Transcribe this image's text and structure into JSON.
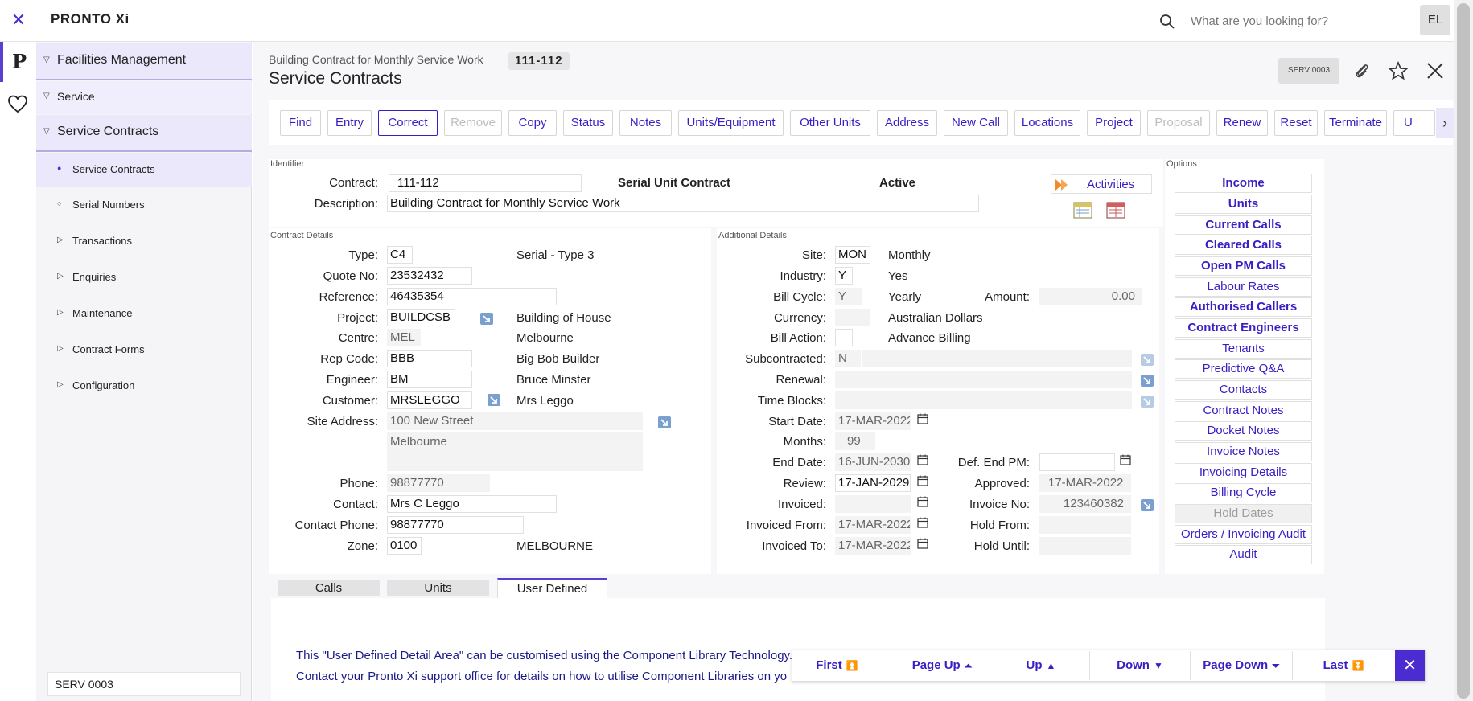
{
  "app": {
    "logo": "PRONTO Xi",
    "search_placeholder": "What are you looking for?",
    "avatar": "EL"
  },
  "sidebar": {
    "items": [
      {
        "label": "Facilities Management"
      },
      {
        "label": "Service"
      },
      {
        "label": "Service Contracts"
      },
      {
        "label": "Service Contracts"
      },
      {
        "label": "Serial Numbers"
      },
      {
        "label": "Transactions"
      },
      {
        "label": "Enquiries"
      },
      {
        "label": "Maintenance"
      },
      {
        "label": "Contract Forms"
      },
      {
        "label": "Configuration"
      }
    ],
    "footer": "SERV 0003"
  },
  "header": {
    "breadcrumb": "Building Contract for Monthly Service Work",
    "badge": "111-112",
    "title": "Service Contracts",
    "program_code": "SERV 0003"
  },
  "toolbar": {
    "buttons": [
      {
        "label": "Find",
        "state": "normal"
      },
      {
        "label": "Entry",
        "state": "normal"
      },
      {
        "label": "Correct",
        "state": "active"
      },
      {
        "label": "Remove",
        "state": "disabled"
      },
      {
        "label": "Copy",
        "state": "normal"
      },
      {
        "label": "Status",
        "state": "normal"
      },
      {
        "label": "Notes",
        "state": "normal"
      },
      {
        "label": "Units/Equipment",
        "state": "normal"
      },
      {
        "label": "Other Units",
        "state": "normal"
      },
      {
        "label": "Address",
        "state": "normal"
      },
      {
        "label": "New Call",
        "state": "normal"
      },
      {
        "label": "Locations",
        "state": "normal"
      },
      {
        "label": "Project",
        "state": "normal"
      },
      {
        "label": "Proposal",
        "state": "disabled"
      },
      {
        "label": "Renew",
        "state": "normal"
      },
      {
        "label": "Reset",
        "state": "normal"
      },
      {
        "label": "Terminate",
        "state": "normal"
      },
      {
        "label": "U",
        "state": "normal"
      }
    ]
  },
  "identifier": {
    "section": "Identifier",
    "contract_label": "Contract:",
    "contract": "111-112",
    "contract_type": "Serial Unit Contract",
    "status": "Active",
    "description_label": "Description:",
    "description": "Building Contract for Monthly Service Work",
    "activities": "Activities"
  },
  "contract_details": {
    "section": "Contract Details",
    "type_label": "Type:",
    "type": "C4",
    "type_desc": "Serial - Type 3",
    "quote_label": "Quote No:",
    "quote": "23532432",
    "reference_label": "Reference:",
    "reference": "46435354",
    "project_label": "Project:",
    "project": "BUILDCSB",
    "project_desc": "Building of House",
    "centre_label": "Centre:",
    "centre": "MEL",
    "centre_desc": "Melbourne",
    "rep_label": "Rep Code:",
    "rep": "BBB",
    "rep_desc": "Big Bob Builder",
    "engineer_label": "Engineer:",
    "engineer": "BM",
    "engineer_desc": "Bruce Minster",
    "customer_label": "Customer:",
    "customer": "MRSLEGGO",
    "customer_desc": "Mrs Leggo",
    "site_label": "Site Address:",
    "site_line1": "100 New Street",
    "site_line2": "Melbourne",
    "phone_label": "Phone:",
    "phone": "98877770",
    "contact_label": "Contact:",
    "contact": "Mrs C Leggo",
    "contact_phone_label": "Contact Phone:",
    "contact_phone": "98877770",
    "zone_label": "Zone:",
    "zone": "0100",
    "zone_desc": "MELBOURNE"
  },
  "additional": {
    "section": "Additional Details",
    "site_label": "Site:",
    "site": "MON",
    "site_desc": "Monthly",
    "industry_label": "Industry:",
    "industry": "Y",
    "industry_desc": "Yes",
    "bill_cycle_label": "Bill Cycle:",
    "bill_cycle": "Y",
    "bill_cycle_desc": "Yearly",
    "amount_label": "Amount:",
    "amount": "0.00",
    "currency_label": "Currency:",
    "currency_desc": "Australian Dollars",
    "bill_action_label": "Bill Action:",
    "bill_action_desc": "Advance Billing",
    "subcontracted_label": "Subcontracted:",
    "subcontracted": "N",
    "renewal_label": "Renewal:",
    "time_blocks_label": "Time Blocks:",
    "start_label": "Start Date:",
    "start": "17-MAR-2022",
    "months_label": "Months:",
    "months": "99",
    "end_label": "End Date:",
    "end": "16-JUN-2030",
    "def_end_label": "Def. End PM:",
    "review_label": "Review:",
    "review": "17-JAN-2029",
    "approved_label": "Approved:",
    "approved": "17-MAR-2022",
    "invoiced_label": "Invoiced:",
    "invoice_no_label": "Invoice No:",
    "invoice_no": "123460382",
    "invoiced_from_label": "Invoiced From:",
    "invoiced_from": "17-MAR-2022",
    "hold_from_label": "Hold From:",
    "invoiced_to_label": "Invoiced To:",
    "invoiced_to": "17-MAR-2022",
    "hold_until_label": "Hold Until:"
  },
  "options": {
    "section": "Options",
    "items": [
      {
        "label": "Income",
        "bold": true
      },
      {
        "label": "Units",
        "bold": true
      },
      {
        "label": "Current Calls",
        "bold": true
      },
      {
        "label": "Cleared Calls",
        "bold": true
      },
      {
        "label": "Open PM Calls",
        "bold": true
      },
      {
        "label": "Labour Rates",
        "bold": false
      },
      {
        "label": "Authorised Callers",
        "bold": true
      },
      {
        "label": "Contract Engineers",
        "bold": true
      },
      {
        "label": "Tenants",
        "bold": false
      },
      {
        "label": "Predictive Q&A",
        "bold": false
      },
      {
        "label": "Contacts",
        "bold": false
      },
      {
        "label": "Contract Notes",
        "bold": false
      },
      {
        "label": "Docket Notes",
        "bold": false
      },
      {
        "label": "Invoice Notes",
        "bold": false
      },
      {
        "label": "Invoicing Details",
        "bold": false
      },
      {
        "label": "Billing Cycle",
        "bold": false
      },
      {
        "label": "Hold Dates",
        "bold": false,
        "disabled": true
      },
      {
        "label": "Orders / Invoicing Audit",
        "bold": false
      },
      {
        "label": "Audit",
        "bold": false
      }
    ]
  },
  "tabs": [
    {
      "label": "Calls"
    },
    {
      "label": "Units"
    },
    {
      "label": "User Defined"
    }
  ],
  "user_defined": {
    "line1": "This \"User Defined Detail Area\" can be customised using the Component Library Technology.",
    "line2": "Contact your Pronto Xi support office for details on how to utilise Component Libraries on yo"
  },
  "pager": {
    "first": "First",
    "page_up": "Page Up",
    "up": "Up",
    "down": "Down",
    "page_down": "Page Down",
    "last": "Last"
  }
}
